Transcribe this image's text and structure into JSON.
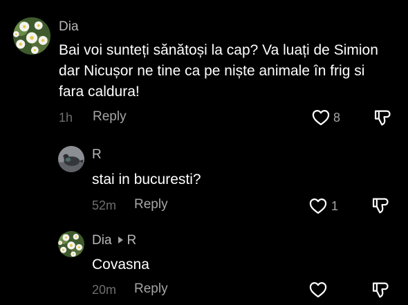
{
  "colors": {
    "background": "#000000",
    "username": "#b8b8b8",
    "text": "#ffffff",
    "meta": "#6e6e6e",
    "action": "#a6a6a6"
  },
  "comments": [
    {
      "username": "Dia",
      "avatar_icon": "daisy-flowers-avatar",
      "text": "Bai voi sunteți sănătoși la cap? Va luați de Simion dar Nicușor ne tine ca pe niște animale în frig si fara caldura!",
      "time": "1h",
      "reply_label": "Reply",
      "like_icon": "heart-outline-icon",
      "like_count": "8",
      "dislike_icon": "thumbs-down-icon"
    },
    {
      "username": "R",
      "avatar_icon": "pigeon-avatar",
      "text": "stai in bucuresti?",
      "time": "52m",
      "reply_label": "Reply",
      "like_icon": "heart-outline-icon",
      "like_count": "1",
      "dislike_icon": "thumbs-down-icon"
    },
    {
      "username": "Dia",
      "replying_to": "R",
      "avatar_icon": "daisy-flowers-avatar",
      "text": "Covasna",
      "time": "20m",
      "reply_label": "Reply",
      "like_icon": "heart-outline-icon",
      "like_count": "",
      "dislike_icon": "thumbs-down-icon"
    }
  ]
}
